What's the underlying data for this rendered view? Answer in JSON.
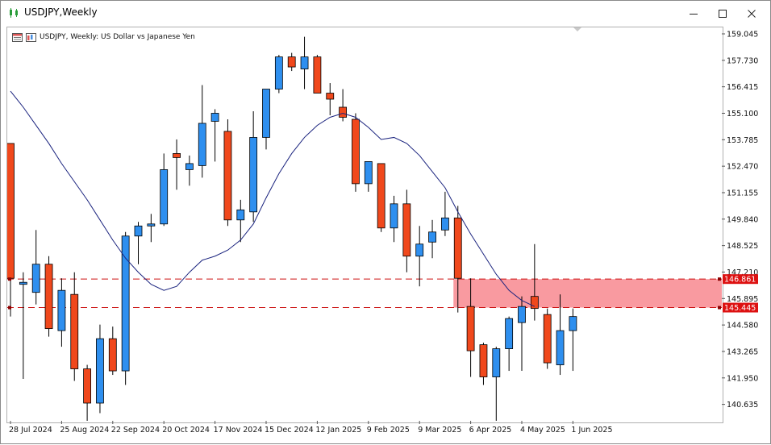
{
  "window": {
    "title": "USDJPY,Weekly",
    "minimize_icon": "minimize-icon",
    "maximize_icon": "maximize-icon",
    "close_icon": "close-icon"
  },
  "chart_label": {
    "text": "USDJPY, Weekly:  US Dollar vs Japanese Yen"
  },
  "colors": {
    "bull": "#2e8fef",
    "bear": "#f0481c",
    "ma": "#1a237e",
    "zone": "#f99aa0",
    "level_line": "#cc1111",
    "level_label_bg": "#dd1111"
  },
  "chart_data": {
    "type": "candlestick",
    "symbol": "USDJPY",
    "timeframe": "Weekly",
    "y_ticks": [
      "159.045",
      "157.730",
      "156.415",
      "155.100",
      "153.785",
      "152.470",
      "151.155",
      "149.840",
      "148.525",
      "147.210",
      "145.895",
      "144.580",
      "143.265",
      "141.950",
      "140.635"
    ],
    "y_tick_values": [
      159.045,
      157.73,
      156.415,
      155.1,
      153.785,
      152.47,
      151.155,
      149.84,
      148.525,
      147.21,
      145.895,
      144.58,
      143.265,
      141.95,
      140.635
    ],
    "x_labels": [
      "28 Jul 2024",
      "25 Aug 2024",
      "22 Sep 2024",
      "20 Oct 2024",
      "17 Nov 2024",
      "15 Dec 2024",
      "12 Jan 2025",
      "9 Feb 2025",
      "9 Mar 2025",
      "6 Apr 2025",
      "4 May 2025",
      "1 Jun 2025"
    ],
    "levels": [
      {
        "label": "146.861",
        "value": 146.861
      },
      {
        "label": "145.445",
        "value": 145.445
      }
    ],
    "candles": [
      {
        "o": 153.6,
        "h": 153.6,
        "l": 145.0,
        "c": 146.9
      },
      {
        "o": 146.6,
        "h": 147.2,
        "l": 141.9,
        "c": 146.7
      },
      {
        "o": 146.2,
        "h": 149.3,
        "l": 145.6,
        "c": 147.6
      },
      {
        "o": 147.6,
        "h": 148.0,
        "l": 144.0,
        "c": 144.4
      },
      {
        "o": 144.3,
        "h": 146.9,
        "l": 143.5,
        "c": 146.3
      },
      {
        "o": 146.1,
        "h": 147.2,
        "l": 141.8,
        "c": 142.4
      },
      {
        "o": 142.4,
        "h": 142.6,
        "l": 139.6,
        "c": 140.7
      },
      {
        "o": 140.7,
        "h": 144.6,
        "l": 140.2,
        "c": 143.9
      },
      {
        "o": 143.9,
        "h": 144.5,
        "l": 142.1,
        "c": 142.3
      },
      {
        "o": 142.3,
        "h": 149.2,
        "l": 141.6,
        "c": 149.0
      },
      {
        "o": 149.0,
        "h": 149.7,
        "l": 147.6,
        "c": 149.5
      },
      {
        "o": 149.5,
        "h": 150.1,
        "l": 148.7,
        "c": 149.6
      },
      {
        "o": 149.6,
        "h": 153.1,
        "l": 149.5,
        "c": 152.3
      },
      {
        "o": 153.1,
        "h": 153.8,
        "l": 151.3,
        "c": 152.9
      },
      {
        "o": 152.3,
        "h": 153.0,
        "l": 151.5,
        "c": 152.6
      },
      {
        "o": 152.5,
        "h": 156.5,
        "l": 151.9,
        "c": 154.6
      },
      {
        "o": 154.7,
        "h": 155.3,
        "l": 152.7,
        "c": 155.1
      },
      {
        "o": 154.2,
        "h": 154.8,
        "l": 149.5,
        "c": 149.8
      },
      {
        "o": 149.8,
        "h": 150.8,
        "l": 148.7,
        "c": 150.3
      },
      {
        "o": 150.2,
        "h": 155.2,
        "l": 149.7,
        "c": 153.9
      },
      {
        "o": 153.9,
        "h": 156.1,
        "l": 153.3,
        "c": 156.3
      },
      {
        "o": 156.3,
        "h": 158.0,
        "l": 156.1,
        "c": 157.9
      },
      {
        "o": 157.9,
        "h": 158.1,
        "l": 157.2,
        "c": 157.4
      },
      {
        "o": 157.3,
        "h": 158.9,
        "l": 156.3,
        "c": 157.9
      },
      {
        "o": 157.9,
        "h": 158.0,
        "l": 156.3,
        "c": 156.1
      },
      {
        "o": 156.1,
        "h": 156.6,
        "l": 155.0,
        "c": 155.8
      },
      {
        "o": 155.4,
        "h": 156.3,
        "l": 154.7,
        "c": 154.9
      },
      {
        "o": 154.8,
        "h": 155.1,
        "l": 151.2,
        "c": 151.6
      },
      {
        "o": 151.6,
        "h": 152.7,
        "l": 151.2,
        "c": 152.7
      },
      {
        "o": 152.6,
        "h": 152.6,
        "l": 149.2,
        "c": 149.4
      },
      {
        "o": 149.4,
        "h": 151.0,
        "l": 148.7,
        "c": 150.6
      },
      {
        "o": 150.6,
        "h": 151.3,
        "l": 147.2,
        "c": 148.0
      },
      {
        "o": 148.0,
        "h": 149.5,
        "l": 146.5,
        "c": 148.6
      },
      {
        "o": 148.7,
        "h": 149.8,
        "l": 147.9,
        "c": 149.2
      },
      {
        "o": 149.3,
        "h": 151.2,
        "l": 149.0,
        "c": 149.9
      },
      {
        "o": 149.9,
        "h": 150.5,
        "l": 145.2,
        "c": 146.9
      },
      {
        "o": 145.5,
        "h": 146.9,
        "l": 142.0,
        "c": 143.3
      },
      {
        "o": 143.6,
        "h": 143.7,
        "l": 141.6,
        "c": 142.0
      },
      {
        "o": 142.0,
        "h": 143.5,
        "l": 139.8,
        "c": 143.4
      },
      {
        "o": 143.4,
        "h": 145.0,
        "l": 142.3,
        "c": 144.9
      },
      {
        "o": 144.7,
        "h": 146.0,
        "l": 142.3,
        "c": 145.5
      },
      {
        "o": 146.0,
        "h": 148.6,
        "l": 144.8,
        "c": 145.4
      },
      {
        "o": 145.1,
        "h": 145.4,
        "l": 142.4,
        "c": 142.7
      },
      {
        "o": 142.6,
        "h": 146.1,
        "l": 142.1,
        "c": 144.3
      },
      {
        "o": 144.3,
        "h": 145.4,
        "l": 142.3,
        "c": 145.0
      }
    ],
    "ma": [
      156.2,
      155.4,
      154.5,
      153.6,
      152.6,
      151.7,
      150.8,
      149.8,
      148.8,
      147.9,
      147.2,
      146.6,
      146.3,
      146.5,
      147.2,
      147.8,
      148.0,
      148.3,
      148.8,
      149.6,
      150.9,
      152.1,
      153.1,
      153.9,
      154.5,
      154.9,
      155.1,
      154.9,
      154.4,
      153.8,
      153.9,
      153.6,
      153.0,
      152.2,
      151.4,
      150.2,
      149.1,
      148.1,
      147.1,
      146.3,
      145.8,
      145.5
    ]
  }
}
